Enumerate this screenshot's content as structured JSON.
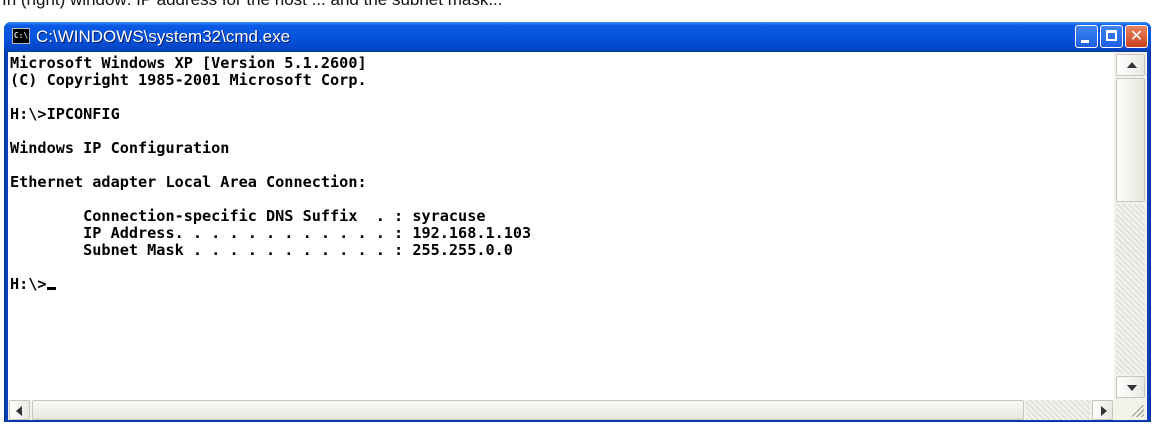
{
  "top_caption": "In (right) window: IP address for the host ... and the subnet mask...",
  "window": {
    "title": "C:\\WINDOWS\\system32\\cmd.exe",
    "icon": "cmd-console-icon",
    "icon_label": "C:\\",
    "controls": {
      "minimize": "minimize-icon",
      "maximize": "maximize-icon",
      "close": "close-icon",
      "close_glyph": "✕"
    }
  },
  "console": {
    "banner_1": "Microsoft Windows XP [Version 5.1.2600]",
    "banner_2": "(C) Copyright 1985-2001 Microsoft Corp.",
    "command_prompt": "H:\\>IPCONFIG",
    "section_header": "Windows IP Configuration",
    "adapter_header": "Ethernet adapter Local Area Connection:",
    "dns_label": "        Connection-specific DNS Suffix  . : ",
    "dns_value": "syracuse",
    "ip_label": "        IP Address. . . . . . . . . . . . : ",
    "ip_value": "192.168.1.103",
    "mask_label": "        Subnet Mask . . . . . . . . . . . : ",
    "mask_value": "255.255.0.0",
    "prompt": "H:\\>"
  },
  "colors": {
    "titlebar": "#0654de",
    "console_background": "#ffffff",
    "console_text": "#000000"
  }
}
